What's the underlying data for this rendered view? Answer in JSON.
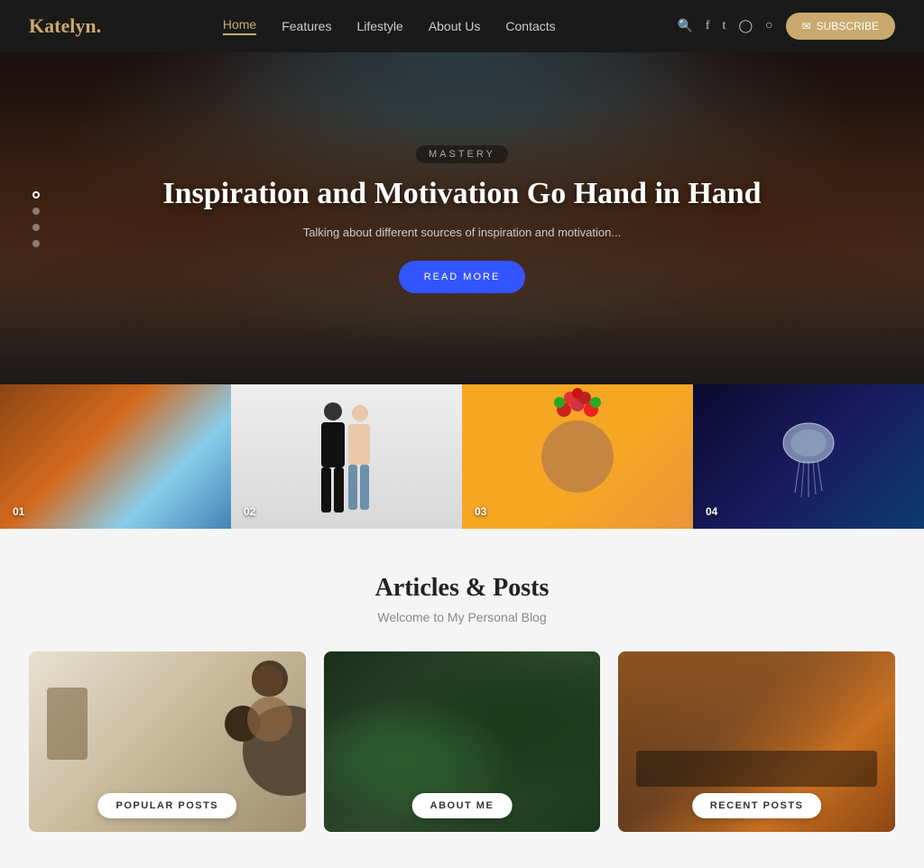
{
  "header": {
    "logo_text": "Katelyn",
    "logo_dot": ".",
    "nav": [
      {
        "label": "Home",
        "active": true
      },
      {
        "label": "Features",
        "active": false
      },
      {
        "label": "Lifestyle",
        "active": false
      },
      {
        "label": "About Us",
        "active": false
      },
      {
        "label": "Contacts",
        "active": false
      }
    ],
    "subscribe_label": "SUBSCRIBE"
  },
  "hero": {
    "tag": "MASTERY",
    "title": "Inspiration and Motivation Go Hand in Hand",
    "subtitle": "Talking about different sources of inspiration and motivation...",
    "button_label": "READ MORE",
    "dots": [
      {
        "active": true
      },
      {
        "active": false
      },
      {
        "active": false
      },
      {
        "active": false
      }
    ]
  },
  "image_grid": [
    {
      "num": "01"
    },
    {
      "num": "02"
    },
    {
      "num": "03"
    },
    {
      "num": "04"
    }
  ],
  "articles": {
    "title": "Articles & Posts",
    "subtitle": "Welcome to My Personal Blog",
    "cards": [
      {
        "label": "POPULAR POSTS"
      },
      {
        "label": "ABOUT ME"
      },
      {
        "label": "RECENT POSTS"
      }
    ]
  }
}
